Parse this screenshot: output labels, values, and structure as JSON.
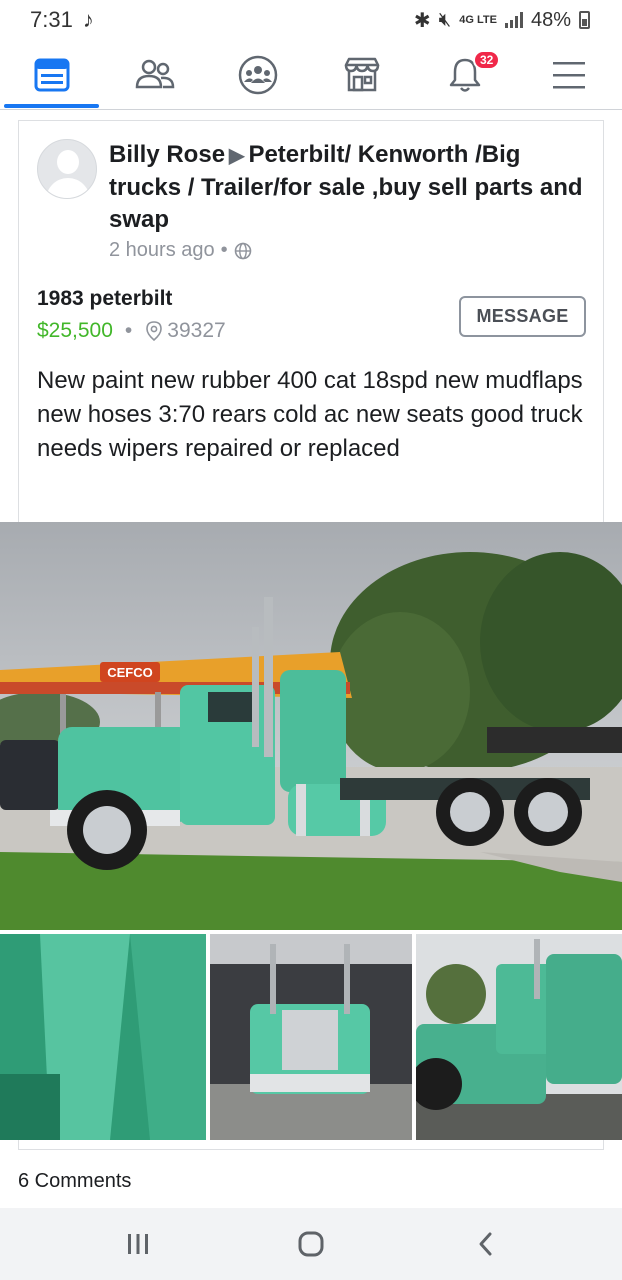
{
  "status_bar": {
    "time": "7:31",
    "network": "4G LTE",
    "battery": "48%"
  },
  "nav": {
    "items": [
      {
        "name": "news-feed",
        "icon": "newsfeed-icon",
        "active": true
      },
      {
        "name": "friends",
        "icon": "friends-icon"
      },
      {
        "name": "groups",
        "icon": "groups-icon"
      },
      {
        "name": "marketplace",
        "icon": "marketplace-icon"
      },
      {
        "name": "notifications",
        "icon": "bell-icon",
        "badge": "32"
      },
      {
        "name": "menu",
        "icon": "hamburger-icon"
      }
    ],
    "accent": "#1877f2"
  },
  "post": {
    "author": "Billy Rose",
    "group": "Peterbilt/ Kenworth /Big trucks / Trailer/for sale ,buy sell parts and swap",
    "time": "2 hours ago",
    "privacy_icon": "globe-icon",
    "item_title": "1983 peterbilt",
    "price": "$25,500",
    "zip": "39327",
    "message_label": "MESSAGE",
    "description": "New paint new rubber 400 cat 18spd new mudflaps new hoses 3:70 rears cold ac new seats good truck needs wipers repaired or replaced",
    "price_color": "#42b72a",
    "sign_text": "CEFCO"
  },
  "comments": {
    "label": "6 Comments"
  }
}
